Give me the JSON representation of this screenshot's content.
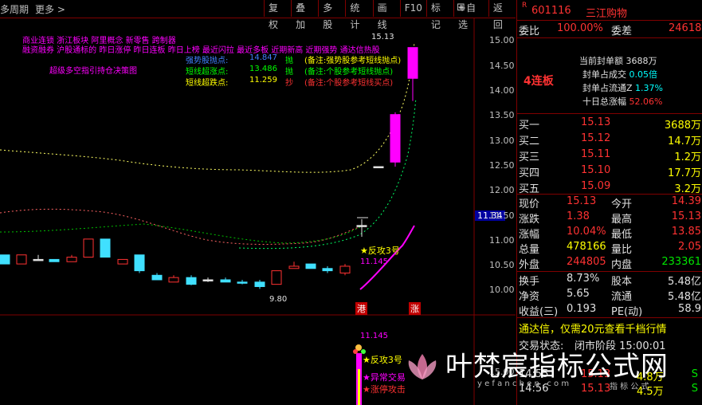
{
  "topbar": {
    "period": "多周期",
    "more": "更多",
    "chevron": ">",
    "buttons": [
      "复权",
      "叠加",
      "多股",
      "统计",
      "画线",
      "F10",
      "标记",
      "+自选",
      "返回"
    ]
  },
  "chart": {
    "indicator_lines": [
      {
        "text": "商业连锁  浙江板块  阿里概念 新零售 跨制器",
        "color": "#ff00ff"
      },
      {
        "text": "融资融券 沪股通标的 昨日涨停 昨日连板 昨日上榜 最近闪拉 最近多板 近期新高 近期强势 通达信热股",
        "color": "#ff00ff"
      }
    ],
    "signals": [
      {
        "label": "强势股抛点:",
        "value": "14.847",
        "tag": "抛",
        "note": "(备注:强势股参考短线抛点)",
        "color": "#4080ff"
      },
      {
        "label": "短线超涨点:",
        "value": "13.486",
        "tag": "抛",
        "note": "(备注:个股参考短线抛点)",
        "color": "#00ff00"
      },
      {
        "label": "短线超跌点:",
        "value": "11.259",
        "tag": "抄",
        "note": "(备注:个股参考短线买点)",
        "color": "#ffff00"
      }
    ],
    "strategy_label": "超级多空指引持仓决策图",
    "price_high_label": "15.13",
    "price_low_label": "9.80",
    "counter_label": "反攻3号",
    "counter_value": "11.145",
    "current_price_tag": "11.34",
    "bottom_tags": [
      "港",
      "涨"
    ],
    "lower_value": "11.145",
    "lower_labels": [
      "反攻3号",
      "异常交易",
      "涨停攻击"
    ],
    "yaxis": [
      "15.00",
      "14.50",
      "14.00",
      "13.50",
      "13.00",
      "12.50",
      "12.00",
      "11.50",
      "11.00",
      "10.50",
      "10.00"
    ],
    "lower_yaxis": "15.00"
  },
  "chart_data": {
    "type": "candlestick",
    "ylim": [
      9.7,
      15.3
    ],
    "candles": [
      {
        "o": 10.55,
        "c": 10.35,
        "h": 10.55,
        "l": 10.35,
        "color": "cyan"
      },
      {
        "o": 10.35,
        "c": 10.55,
        "h": 10.55,
        "l": 10.35,
        "color": "red"
      },
      {
        "o": 10.45,
        "c": 10.45,
        "h": 10.55,
        "l": 10.45,
        "color": "white"
      },
      {
        "o": 10.45,
        "c": 10.4,
        "h": 10.45,
        "l": 10.4,
        "color": "cyan"
      },
      {
        "o": 10.4,
        "c": 10.5,
        "h": 10.55,
        "l": 10.4,
        "color": "red"
      },
      {
        "o": 10.5,
        "c": 10.9,
        "h": 10.9,
        "l": 10.5,
        "color": "red"
      },
      {
        "o": 10.9,
        "c": 10.5,
        "h": 10.9,
        "l": 10.5,
        "color": "cyan"
      },
      {
        "o": 10.45,
        "c": 10.35,
        "h": 10.45,
        "l": 10.35,
        "color": "red"
      },
      {
        "o": 10.55,
        "c": 10.2,
        "h": 10.55,
        "l": 10.15,
        "color": "cyan"
      },
      {
        "o": 10.1,
        "c": 10.0,
        "h": 10.15,
        "l": 10.0,
        "color": "cyan"
      },
      {
        "o": 9.95,
        "c": 10.05,
        "h": 10.1,
        "l": 9.95,
        "color": "red"
      },
      {
        "o": 10.05,
        "c": 9.9,
        "h": 10.1,
        "l": 9.88,
        "color": "cyan"
      },
      {
        "o": 10.0,
        "c": 10.0,
        "h": 10.05,
        "l": 9.95,
        "color": "white"
      },
      {
        "o": 10.0,
        "c": 9.95,
        "h": 10.05,
        "l": 9.95,
        "color": "cyan"
      },
      {
        "o": 9.95,
        "c": 9.95,
        "h": 10.0,
        "l": 9.9,
        "color": "cyan"
      },
      {
        "o": 9.95,
        "c": 9.85,
        "h": 10.0,
        "l": 9.8,
        "color": "cyan"
      },
      {
        "o": 9.9,
        "c": 10.2,
        "h": 10.2,
        "l": 9.9,
        "color": "red"
      },
      {
        "o": 10.25,
        "c": 10.3,
        "h": 10.4,
        "l": 10.25,
        "color": "red"
      },
      {
        "o": 10.35,
        "c": 10.25,
        "h": 10.35,
        "l": 10.25,
        "color": "cyan"
      },
      {
        "o": 10.25,
        "c": 10.2,
        "h": 10.3,
        "l": 10.15,
        "color": "cyan"
      },
      {
        "o": 10.15,
        "c": 10.3,
        "h": 10.35,
        "l": 10.1,
        "color": "red"
      },
      {
        "o": 11.2,
        "c": 11.2,
        "h": 11.34,
        "l": 10.95,
        "color": "white"
      },
      {
        "o": 12.5,
        "c": 12.5,
        "h": 12.5,
        "l": 12.5,
        "color": "white"
      },
      {
        "o": 12.6,
        "c": 13.65,
        "h": 13.7,
        "l": 12.5,
        "color": "magenta"
      },
      {
        "o": 14.45,
        "c": 15.13,
        "h": 15.13,
        "l": 13.95,
        "color": "magenta"
      }
    ]
  },
  "panel": {
    "code_prefix": "R",
    "code": "601116",
    "name": "三江购物",
    "weibi_label": "委比",
    "weibi_value": "100.00%",
    "weicha_label": "委差",
    "weicha_value": "24618",
    "seal_lines": [
      {
        "label": "当前封单额",
        "value": "3688万"
      },
      {
        "label": "封单占成交",
        "value": "0.05倍"
      },
      {
        "label": "封单占流通Z",
        "value": "1.37%"
      },
      {
        "label": "十日总涨幅",
        "value": "52.06%"
      }
    ],
    "board": "4连板",
    "bids": [
      {
        "label": "买一",
        "price": "15.13",
        "vol": "3688万"
      },
      {
        "label": "买二",
        "price": "15.12",
        "vol": "14.7万"
      },
      {
        "label": "买三",
        "price": "15.11",
        "vol": "1.2万"
      },
      {
        "label": "买四",
        "price": "15.10",
        "vol": "17.7万"
      },
      {
        "label": "买五",
        "price": "15.09",
        "vol": "3.2万"
      }
    ],
    "quote": [
      {
        "l1": "现价",
        "v1": "15.13",
        "l2": "今开",
        "v2": "14.39",
        "c1": "red",
        "c2": "red"
      },
      {
        "l1": "涨跌",
        "v1": "1.38",
        "l2": "最高",
        "v2": "15.13",
        "c1": "red",
        "c2": "red"
      },
      {
        "l1": "涨幅",
        "v1": "10.04%",
        "l2": "最低",
        "v2": "13.85",
        "c1": "red",
        "c2": "red"
      },
      {
        "l1": "总量",
        "v1": "478166",
        "l2": "量比",
        "v2": "2.05",
        "c1": "yellow",
        "c2": "red"
      },
      {
        "l1": "外盘",
        "v1": "244805",
        "l2": "内盘",
        "v2": "233361",
        "c1": "red",
        "c2": "green"
      }
    ],
    "fund": [
      {
        "l1": "换手",
        "v1": "8.73%",
        "l2": "股本",
        "v2": "5.48亿"
      },
      {
        "l1": "净资",
        "v1": "5.65",
        "l2": "流通",
        "v2": "5.48亿"
      },
      {
        "l1": "收益(三)",
        "v1": "0.193",
        "l2": "PE(动)",
        "v2": "58.9"
      }
    ],
    "ad": "通达信，仅需20元查看千档行情",
    "trade_status_label": "交易状态:",
    "trade_status": "闭市阶段 15:00:01",
    "ticks": [
      {
        "time": "14:55",
        "price": "15.13",
        "vol": "4.8万",
        "dir": "S"
      },
      {
        "time": "14:56",
        "price": "15.13",
        "vol": "4.5万",
        "dir": "S"
      }
    ]
  },
  "watermark": {
    "title": "叶梵宸指标公式网",
    "url": "y e f a n c h e n . c o m",
    "sub": "指 标 公 式"
  }
}
